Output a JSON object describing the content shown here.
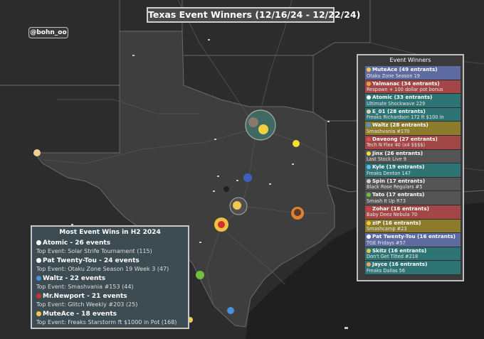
{
  "title": "Texas Event Winners (12/16/24 - 12/22/24)",
  "handle": "@bohn_oo",
  "event_winners": {
    "title": "Event Winners",
    "items": [
      {
        "name": "MuteAce (49 entrants)",
        "event": "Otaku Zone Season 19",
        "color": "#5d6ba0",
        "icon": "#f0c850"
      },
      {
        "name": "Yalmanac (34 entrants)",
        "event": "Respawn + 100 dollar pot bonus",
        "color": "#a34646",
        "icon": "#f0a040"
      },
      {
        "name": "Atomic (33 entrants)",
        "event": "Ultimate Shockwave 229",
        "color": "#2f7474",
        "icon": "#ffffff"
      },
      {
        "name": "E_01 (28 entrants)",
        "event": "Freaks Richardson 172 ft $100 in",
        "color": "#2f7474",
        "icon": "#e0d0b0"
      },
      {
        "name": "Waltz (28 entrants)",
        "event": "Smashvania #170",
        "color": "#8b7b2a",
        "icon": "#4a90e0"
      },
      {
        "name": "Daveong (27 entrants)",
        "event": "Tech N Flex 40 (x4 $$$$)",
        "color": "#a34646",
        "icon": "#e05050"
      },
      {
        "name": "Jinx (26 entrants)",
        "event": "Last Stock Live 9",
        "color": "#555555",
        "icon": "#f0e040"
      },
      {
        "name": "Kyle (19 entrants)",
        "event": "Freaks Denton 147",
        "color": "#2f7474",
        "icon": "#60c0f0"
      },
      {
        "name": "Spin (17 entrants)",
        "event": "Black Rose Regulars #5",
        "color": "#555555",
        "icon": "#d0d0d0"
      },
      {
        "name": "Tato (17 entrants)",
        "event": "Smash It Up R73",
        "color": "#555555",
        "icon": "#70c040"
      },
      {
        "name": "Zohar (16 entrants)",
        "event": "Baby Deez Nebula 70",
        "color": "#a34646",
        "icon": "#d04040"
      },
      {
        "name": "zIP (16 entrants)",
        "event": "Smashcamp #23",
        "color": "#8b7b2a",
        "icon": "#f0d030"
      },
      {
        "name": "Pat Twenty-Tou (16 entrants)",
        "event": "TGE Fridays #57",
        "color": "#5d6ba0",
        "icon": "#ffffff"
      },
      {
        "name": "Skitz (16 entrants)",
        "event": "Don't Get Tilted #218",
        "color": "#2f7474",
        "icon": "#f0c050"
      },
      {
        "name": "Jayce (16 entrants)",
        "event": "Freaks Dallas 56",
        "color": "#2f7474",
        "icon": "#f0a060"
      }
    ]
  },
  "most_wins": {
    "title": "Most Event Wins in H2 2024",
    "items": [
      {
        "name": "Atomic - 26 events",
        "event": "Top Event: Solar Strife Tournament (115)",
        "icon": "#ffffff"
      },
      {
        "name": "Pat Twenty-Tou  - 24 events",
        "event": "Top Event: Otaku Zone Season 19 Week 3 (47)",
        "icon": "#ffffff"
      },
      {
        "name": "Waltz - 22 events",
        "event": "Top Event: Smashvania #153 (44)",
        "icon": "#4a90e0"
      },
      {
        "name": "Mr.Newport - 21 events",
        "event": "Top Event: Glitch Weekly #203 (25)",
        "icon": "#d03030"
      },
      {
        "name": "MuteAce - 18 events",
        "event": "Top Event: Freaks Starstorm ft $1000 in Pot (168)",
        "icon": "#f0c850"
      }
    ]
  },
  "map_markers": [
    {
      "name": "dfw-cluster",
      "color": "#f0d040",
      "size": "large"
    },
    {
      "name": "east-texas",
      "color": "#f0e030",
      "size": "small"
    },
    {
      "name": "el-paso",
      "color": "#f0d090",
      "size": "small"
    },
    {
      "name": "waco-austin",
      "color": "#4060c0",
      "size": "small"
    },
    {
      "name": "austin",
      "color": "#8060a0",
      "size": "medium"
    },
    {
      "name": "san-antonio",
      "color": "#f0c040",
      "size": "medium"
    },
    {
      "name": "houston",
      "color": "#e08030",
      "size": "medium"
    },
    {
      "name": "laredo",
      "color": "#70c040",
      "size": "small"
    },
    {
      "name": "rio-grande",
      "color": "#4a90e0",
      "size": "small"
    },
    {
      "name": "south-texas",
      "color": "#f0d050",
      "size": "small"
    }
  ]
}
